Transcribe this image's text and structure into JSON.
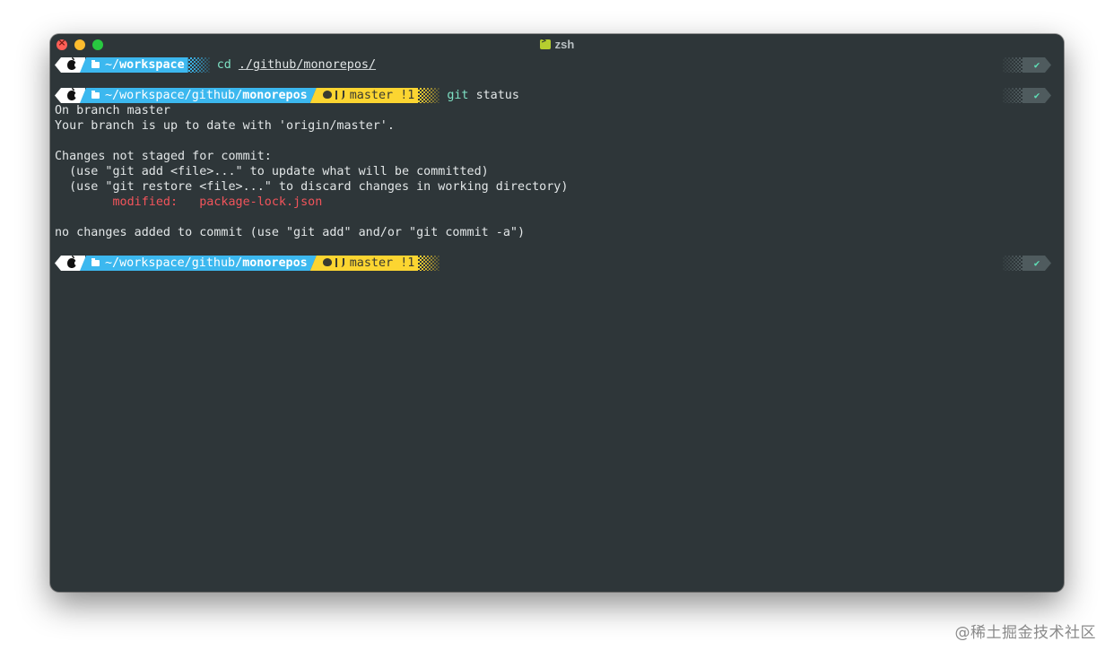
{
  "window": {
    "title": "zsh",
    "title_icon": "terminal-icon"
  },
  "prompts": [
    {
      "path_dir": "~/",
      "path_leaf": "workspace",
      "git": null,
      "command": "cd",
      "argument": "./github/monorepos/",
      "status": "✔"
    },
    {
      "path_dir": "~/workspace/github/",
      "path_leaf": "monorepos",
      "git": {
        "branch": "master",
        "changes": "!1"
      },
      "command": "git",
      "argument": "status",
      "status": "✔"
    },
    {
      "path_dir": "~/workspace/github/",
      "path_leaf": "monorepos",
      "git": {
        "branch": "master",
        "changes": "!1"
      },
      "command": "",
      "argument": "",
      "status": "✔"
    }
  ],
  "output": {
    "line1": "On branch master",
    "line2": "Your branch is up to date with 'origin/master'.",
    "line3": "Changes not staged for commit:",
    "line4": "  (use \"git add <file>...\" to update what will be committed)",
    "line5": "  (use \"git restore <file>...\" to discard changes in working directory)",
    "modified_label": "modified:",
    "modified_file": "package-lock.json",
    "line7": "no changes added to commit (use \"git add\" and/or \"git commit -a\")"
  },
  "watermark": "@稀土掘金技术社区",
  "colors": {
    "background": "#2e3639",
    "path_segment": "#3cb8ef",
    "git_segment": "#fcd531",
    "command": "#7ee1c4",
    "modified": "#f2545b",
    "status_ok": "#5fe0b7"
  }
}
